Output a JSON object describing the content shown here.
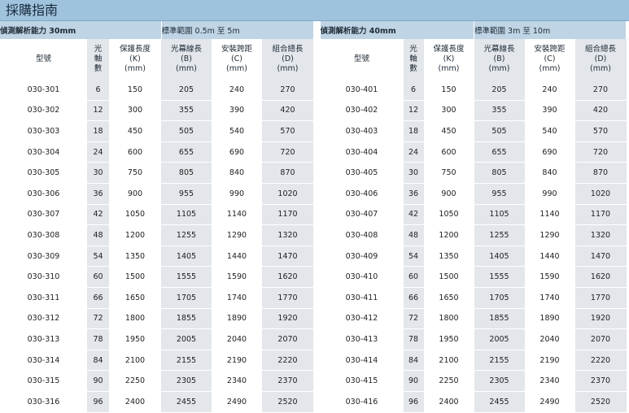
{
  "title": "採購指南",
  "panels": [
    {
      "resolution_label": "偵測解析能力 30mm",
      "range_label": "標準範圍 0.5m 至 5m",
      "headers": {
        "model": "型號",
        "axes": [
          "光",
          "軸",
          "數"
        ],
        "protected_length": [
          "保護長度",
          "(K)",
          "(mm)"
        ],
        "curtain_length": [
          "光幕線長",
          "(B)",
          "(mm)"
        ],
        "install_span": [
          "安裝跨距",
          "(C)",
          "(mm)"
        ],
        "assembly_length": [
          "組合總長",
          "(D)",
          "(mm)"
        ]
      },
      "rows": [
        [
          "030-301",
          "6",
          "150",
          "205",
          "240",
          "270"
        ],
        [
          "030-302",
          "12",
          "300",
          "355",
          "390",
          "420"
        ],
        [
          "030-303",
          "18",
          "450",
          "505",
          "540",
          "570"
        ],
        [
          "030-304",
          "24",
          "600",
          "655",
          "690",
          "720"
        ],
        [
          "030-305",
          "30",
          "750",
          "805",
          "840",
          "870"
        ],
        [
          "030-306",
          "36",
          "900",
          "955",
          "990",
          "1020"
        ],
        [
          "030-307",
          "42",
          "1050",
          "1105",
          "1140",
          "1170"
        ],
        [
          "030-308",
          "48",
          "1200",
          "1255",
          "1290",
          "1320"
        ],
        [
          "030-309",
          "54",
          "1350",
          "1405",
          "1440",
          "1470"
        ],
        [
          "030-310",
          "60",
          "1500",
          "1555",
          "1590",
          "1620"
        ],
        [
          "030-311",
          "66",
          "1650",
          "1705",
          "1740",
          "1770"
        ],
        [
          "030-312",
          "72",
          "1800",
          "1855",
          "1890",
          "1920"
        ],
        [
          "030-313",
          "78",
          "1950",
          "2005",
          "2040",
          "2070"
        ],
        [
          "030-314",
          "84",
          "2100",
          "2155",
          "2190",
          "2220"
        ],
        [
          "030-315",
          "90",
          "2250",
          "2305",
          "2340",
          "2370"
        ],
        [
          "030-316",
          "96",
          "2400",
          "2455",
          "2490",
          "2520"
        ]
      ]
    },
    {
      "resolution_label": "偵測解析能力 40mm",
      "range_label": "標準範圍 3m 至 10m",
      "headers": {
        "model": "型號",
        "axes": [
          "光",
          "軸",
          "數"
        ],
        "protected_length": [
          "保護長度",
          "(K)",
          "(mm)"
        ],
        "curtain_length": [
          "光幕線長",
          "(B)",
          "(mm)"
        ],
        "install_span": [
          "安裝跨距",
          "(C)",
          "(mm)"
        ],
        "assembly_length": [
          "組合總長",
          "(D)",
          "(mm)"
        ]
      },
      "rows": [
        [
          "030-401",
          "6",
          "150",
          "205",
          "240",
          "270"
        ],
        [
          "030-402",
          "12",
          "300",
          "355",
          "390",
          "420"
        ],
        [
          "030-403",
          "18",
          "450",
          "505",
          "540",
          "570"
        ],
        [
          "030-404",
          "24",
          "600",
          "655",
          "690",
          "720"
        ],
        [
          "030-405",
          "30",
          "750",
          "805",
          "840",
          "870"
        ],
        [
          "030-406",
          "36",
          "900",
          "955",
          "990",
          "1020"
        ],
        [
          "030-407",
          "42",
          "1050",
          "1105",
          "1140",
          "1170"
        ],
        [
          "030-408",
          "48",
          "1200",
          "1255",
          "1290",
          "1320"
        ],
        [
          "030-409",
          "54",
          "1350",
          "1405",
          "1440",
          "1470"
        ],
        [
          "030-410",
          "60",
          "1500",
          "1555",
          "1590",
          "1620"
        ],
        [
          "030-411",
          "66",
          "1650",
          "1705",
          "1740",
          "1770"
        ],
        [
          "030-412",
          "72",
          "1800",
          "1855",
          "1890",
          "1920"
        ],
        [
          "030-413",
          "78",
          "1950",
          "2005",
          "2040",
          "2070"
        ],
        [
          "030-414",
          "84",
          "2100",
          "2155",
          "2190",
          "2220"
        ],
        [
          "030-415",
          "90",
          "2250",
          "2305",
          "2340",
          "2370"
        ],
        [
          "030-416",
          "96",
          "2400",
          "2455",
          "2490",
          "2520"
        ]
      ]
    }
  ]
}
